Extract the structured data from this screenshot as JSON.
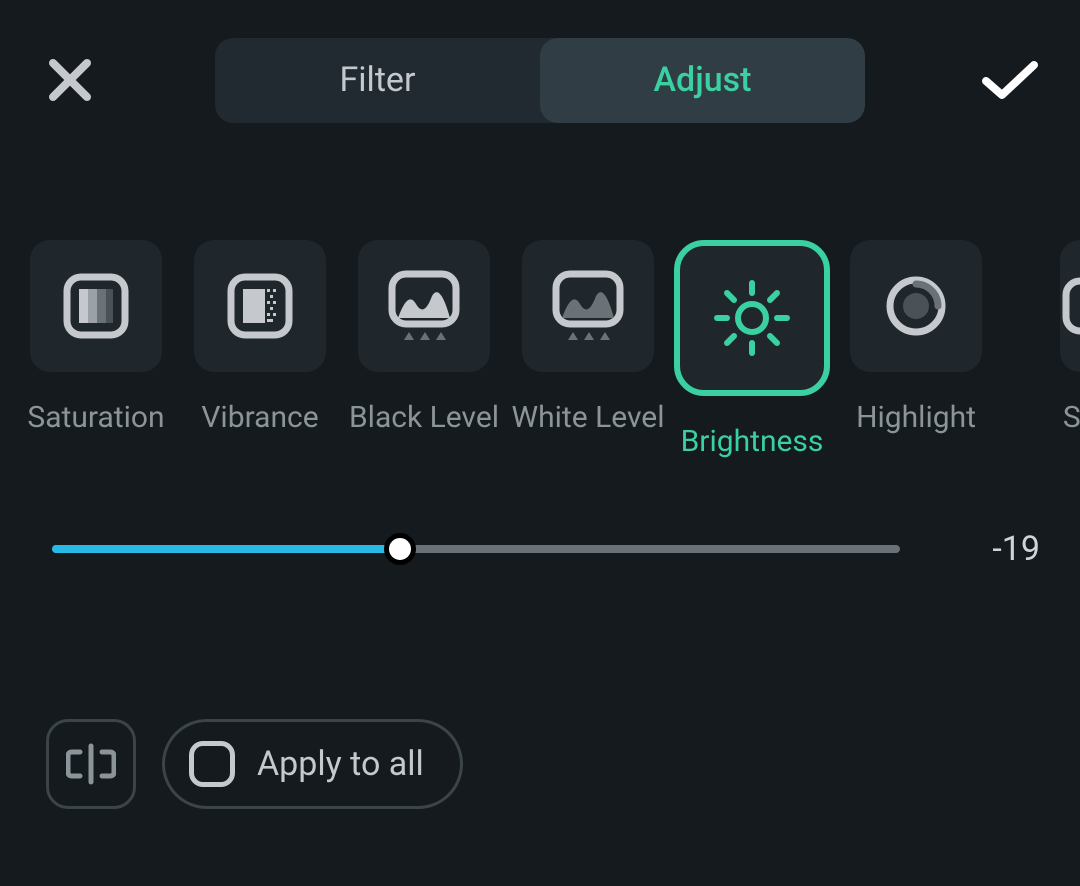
{
  "header": {
    "tabs": [
      {
        "label": "Filter",
        "active": false
      },
      {
        "label": "Adjust",
        "active": true
      }
    ]
  },
  "adjustments": [
    {
      "key": "saturation",
      "label": "Saturation",
      "icon": "saturation-icon",
      "selected": false
    },
    {
      "key": "vibrance",
      "label": "Vibrance",
      "icon": "vibrance-icon",
      "selected": false
    },
    {
      "key": "black-level",
      "label": "Black Level",
      "icon": "black-level-icon",
      "selected": false
    },
    {
      "key": "white-level",
      "label": "White Level",
      "icon": "white-level-icon",
      "selected": false
    },
    {
      "key": "brightness",
      "label": "Brightness",
      "icon": "brightness-icon",
      "selected": true
    },
    {
      "key": "highlight",
      "label": "Highlight",
      "icon": "highlight-icon",
      "selected": false
    },
    {
      "key": "shadow",
      "label": "Sh",
      "icon": "shadow-icon",
      "selected": false
    }
  ],
  "slider": {
    "value": "-19",
    "fill_percent": 41
  },
  "bottom": {
    "apply_all_label": "Apply to all",
    "apply_all_checked": false
  },
  "colors": {
    "accent": "#3ad0a2",
    "slider_fill": "#29b9e6",
    "bg": "#141a1e",
    "tile": "#1f272c"
  }
}
